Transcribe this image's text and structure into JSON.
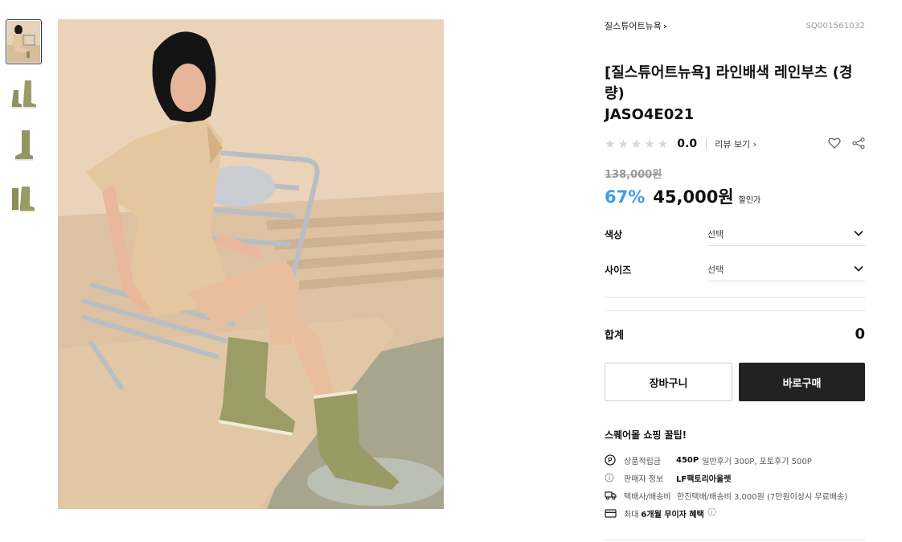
{
  "gallery": {
    "thumbnails": [
      {
        "name": "thumbnail-model",
        "active": true
      },
      {
        "name": "thumbnail-boots-pair-side"
      },
      {
        "name": "thumbnail-boot-single"
      },
      {
        "name": "thumbnail-boots-front"
      }
    ],
    "main_image_alt": "model wearing olive rain boots"
  },
  "product": {
    "brand": "질스튜어트뉴욕",
    "code": "SQ001561032",
    "title_line1": "[질스튜어트뉴욕] 라인배색 레인부츠 (경량)",
    "title_line2": "JASO4E021",
    "rating_score": "0.0",
    "review_link": "리뷰 보기",
    "original_price": "138,000원",
    "discount_rate": "67%",
    "price": "45,000원",
    "price_tag": "할인가"
  },
  "options": [
    {
      "label": "색상",
      "value": "선택"
    },
    {
      "label": "사이즈",
      "value": "선택"
    }
  ],
  "total": {
    "label": "합계",
    "value": "0"
  },
  "buttons": {
    "cart": "장바구니",
    "buy": "바로구매"
  },
  "tips": {
    "title": "스퀘어몰 쇼핑 꿀팁!",
    "points_label": "상품적립금",
    "points_value": "450P",
    "points_detail": "일반후기 300P, 포토후기 500P",
    "seller_label": "판매자 정보",
    "seller_value": "LF팩토리아울렛",
    "delivery_label": "택배사/배송비",
    "delivery_value": "한진택배/배송비 3,000원 (7만원이상시 무료배송)",
    "installment_prefix": "최대",
    "installment_value": "6개월 무이자 혜택"
  },
  "colors": {
    "discount": "#3d9be9",
    "buy_button": "#222222",
    "boot_olive": "#9a9a62"
  }
}
